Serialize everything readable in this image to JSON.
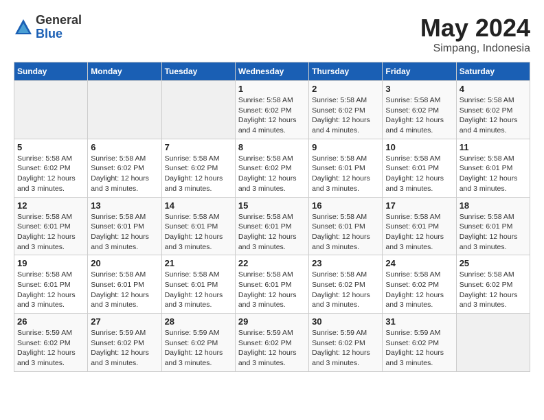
{
  "logo": {
    "general": "General",
    "blue": "Blue"
  },
  "title": "May 2024",
  "subtitle": "Simpang, Indonesia",
  "days_of_week": [
    "Sunday",
    "Monday",
    "Tuesday",
    "Wednesday",
    "Thursday",
    "Friday",
    "Saturday"
  ],
  "weeks": [
    [
      {
        "day": "",
        "info": ""
      },
      {
        "day": "",
        "info": ""
      },
      {
        "day": "",
        "info": ""
      },
      {
        "day": "1",
        "info": "Sunrise: 5:58 AM\nSunset: 6:02 PM\nDaylight: 12 hours\nand 4 minutes."
      },
      {
        "day": "2",
        "info": "Sunrise: 5:58 AM\nSunset: 6:02 PM\nDaylight: 12 hours\nand 4 minutes."
      },
      {
        "day": "3",
        "info": "Sunrise: 5:58 AM\nSunset: 6:02 PM\nDaylight: 12 hours\nand 4 minutes."
      },
      {
        "day": "4",
        "info": "Sunrise: 5:58 AM\nSunset: 6:02 PM\nDaylight: 12 hours\nand 4 minutes."
      }
    ],
    [
      {
        "day": "5",
        "info": "Sunrise: 5:58 AM\nSunset: 6:02 PM\nDaylight: 12 hours\nand 3 minutes."
      },
      {
        "day": "6",
        "info": "Sunrise: 5:58 AM\nSunset: 6:02 PM\nDaylight: 12 hours\nand 3 minutes."
      },
      {
        "day": "7",
        "info": "Sunrise: 5:58 AM\nSunset: 6:02 PM\nDaylight: 12 hours\nand 3 minutes."
      },
      {
        "day": "8",
        "info": "Sunrise: 5:58 AM\nSunset: 6:02 PM\nDaylight: 12 hours\nand 3 minutes."
      },
      {
        "day": "9",
        "info": "Sunrise: 5:58 AM\nSunset: 6:01 PM\nDaylight: 12 hours\nand 3 minutes."
      },
      {
        "day": "10",
        "info": "Sunrise: 5:58 AM\nSunset: 6:01 PM\nDaylight: 12 hours\nand 3 minutes."
      },
      {
        "day": "11",
        "info": "Sunrise: 5:58 AM\nSunset: 6:01 PM\nDaylight: 12 hours\nand 3 minutes."
      }
    ],
    [
      {
        "day": "12",
        "info": "Sunrise: 5:58 AM\nSunset: 6:01 PM\nDaylight: 12 hours\nand 3 minutes."
      },
      {
        "day": "13",
        "info": "Sunrise: 5:58 AM\nSunset: 6:01 PM\nDaylight: 12 hours\nand 3 minutes."
      },
      {
        "day": "14",
        "info": "Sunrise: 5:58 AM\nSunset: 6:01 PM\nDaylight: 12 hours\nand 3 minutes."
      },
      {
        "day": "15",
        "info": "Sunrise: 5:58 AM\nSunset: 6:01 PM\nDaylight: 12 hours\nand 3 minutes."
      },
      {
        "day": "16",
        "info": "Sunrise: 5:58 AM\nSunset: 6:01 PM\nDaylight: 12 hours\nand 3 minutes."
      },
      {
        "day": "17",
        "info": "Sunrise: 5:58 AM\nSunset: 6:01 PM\nDaylight: 12 hours\nand 3 minutes."
      },
      {
        "day": "18",
        "info": "Sunrise: 5:58 AM\nSunset: 6:01 PM\nDaylight: 12 hours\nand 3 minutes."
      }
    ],
    [
      {
        "day": "19",
        "info": "Sunrise: 5:58 AM\nSunset: 6:01 PM\nDaylight: 12 hours\nand 3 minutes."
      },
      {
        "day": "20",
        "info": "Sunrise: 5:58 AM\nSunset: 6:01 PM\nDaylight: 12 hours\nand 3 minutes."
      },
      {
        "day": "21",
        "info": "Sunrise: 5:58 AM\nSunset: 6:01 PM\nDaylight: 12 hours\nand 3 minutes."
      },
      {
        "day": "22",
        "info": "Sunrise: 5:58 AM\nSunset: 6:01 PM\nDaylight: 12 hours\nand 3 minutes."
      },
      {
        "day": "23",
        "info": "Sunrise: 5:58 AM\nSunset: 6:02 PM\nDaylight: 12 hours\nand 3 minutes."
      },
      {
        "day": "24",
        "info": "Sunrise: 5:58 AM\nSunset: 6:02 PM\nDaylight: 12 hours\nand 3 minutes."
      },
      {
        "day": "25",
        "info": "Sunrise: 5:58 AM\nSunset: 6:02 PM\nDaylight: 12 hours\nand 3 minutes."
      }
    ],
    [
      {
        "day": "26",
        "info": "Sunrise: 5:59 AM\nSunset: 6:02 PM\nDaylight: 12 hours\nand 3 minutes."
      },
      {
        "day": "27",
        "info": "Sunrise: 5:59 AM\nSunset: 6:02 PM\nDaylight: 12 hours\nand 3 minutes."
      },
      {
        "day": "28",
        "info": "Sunrise: 5:59 AM\nSunset: 6:02 PM\nDaylight: 12 hours\nand 3 minutes."
      },
      {
        "day": "29",
        "info": "Sunrise: 5:59 AM\nSunset: 6:02 PM\nDaylight: 12 hours\nand 3 minutes."
      },
      {
        "day": "30",
        "info": "Sunrise: 5:59 AM\nSunset: 6:02 PM\nDaylight: 12 hours\nand 3 minutes."
      },
      {
        "day": "31",
        "info": "Sunrise: 5:59 AM\nSunset: 6:02 PM\nDaylight: 12 hours\nand 3 minutes."
      },
      {
        "day": "",
        "info": ""
      }
    ]
  ]
}
